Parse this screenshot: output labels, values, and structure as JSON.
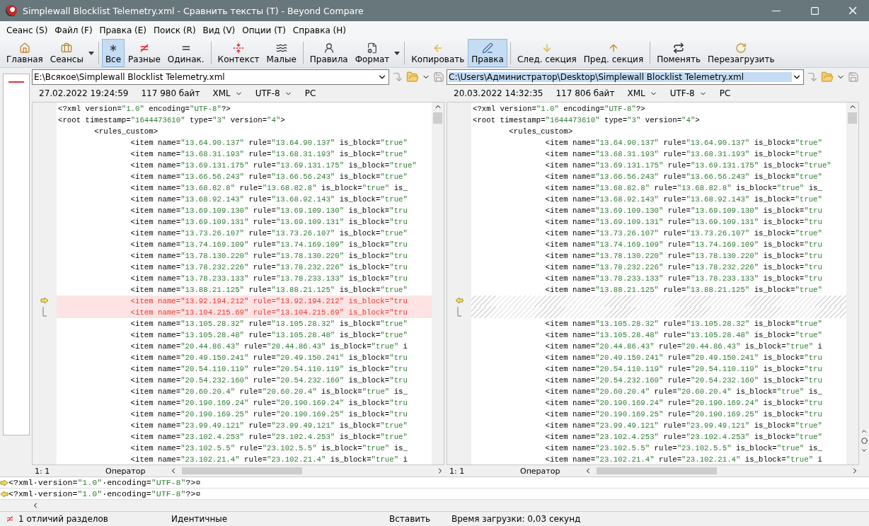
{
  "window": {
    "title": "Simplewall Blocklist Telemetry.xml - Сравнить тексты (T) - Beyond Compare"
  },
  "menu": [
    "Сеанс (S)",
    "Файл (F)",
    "Правка (E)",
    "Поиск (R)",
    "Вид (V)",
    "Опции (T)",
    "Справка (H)"
  ],
  "toolbar": [
    {
      "kind": "button",
      "label": "Главная",
      "selected": false,
      "dropdown": false
    },
    {
      "kind": "button",
      "label": "Сеансы",
      "selected": false,
      "dropdown": true
    },
    {
      "kind": "separator"
    },
    {
      "kind": "button",
      "label": "Все",
      "selected": true,
      "dropdown": false
    },
    {
      "kind": "button",
      "label": "Разные",
      "selected": false,
      "dropdown": false
    },
    {
      "kind": "button",
      "label": "Одинак.",
      "selected": false,
      "dropdown": false
    },
    {
      "kind": "separator"
    },
    {
      "kind": "button",
      "label": "Контекст",
      "selected": false,
      "dropdown": false
    },
    {
      "kind": "button",
      "label": "Малые",
      "selected": false,
      "dropdown": false
    },
    {
      "kind": "separator"
    },
    {
      "kind": "button",
      "label": "Правила",
      "selected": false,
      "dropdown": false
    },
    {
      "kind": "button",
      "label": "Формат",
      "selected": false,
      "dropdown": true
    },
    {
      "kind": "separator"
    },
    {
      "kind": "button",
      "label": "Копировать",
      "selected": false,
      "dropdown": false
    },
    {
      "kind": "button",
      "label": "Правка",
      "selected": true,
      "dropdown": false
    },
    {
      "kind": "separator"
    },
    {
      "kind": "button",
      "label": "След. секция",
      "selected": false,
      "dropdown": false
    },
    {
      "kind": "button",
      "label": "Пред. секция",
      "selected": false,
      "dropdown": false
    },
    {
      "kind": "separator"
    },
    {
      "kind": "button",
      "label": "Поменять",
      "selected": false,
      "dropdown": false
    },
    {
      "kind": "button",
      "label": "Перезагрузить",
      "selected": false,
      "dropdown": false
    }
  ],
  "panes": [
    {
      "path": "E:\\Всякое\\Simplewall Blocklist Telemetry.xml",
      "path_selected": false,
      "date": "27.02.2022 19:24:59",
      "size": "117 980 байт",
      "format": "XML",
      "encoding": "UTF-8",
      "line_endings": "PC",
      "position": "1: 1",
      "mode": "Оператор",
      "lines": [
        {
          "kind": "same",
          "text": "<?xml version=\"1.0\" encoding=\"UTF-8\"?>"
        },
        {
          "kind": "same",
          "text": "<root timestamp=\"1644473610\" type=\"3\" version=\"4\">"
        },
        {
          "kind": "same",
          "text": "        <rules_custom>"
        },
        {
          "kind": "same",
          "text": "                <item name=\"13.64.90.137\" rule=\"13.64.90.137\" is_block=\"true\""
        },
        {
          "kind": "same",
          "text": "                <item name=\"13.68.31.193\" rule=\"13.68.31.193\" is_block=\"true\""
        },
        {
          "kind": "same",
          "text": "                <item name=\"13.69.131.175\" rule=\"13.69.131.175\" is_block=\"true\""
        },
        {
          "kind": "same",
          "text": "                <item name=\"13.66.56.243\" rule=\"13.66.56.243\" is_block=\"true\""
        },
        {
          "kind": "same",
          "text": "                <item name=\"13.68.82.8\" rule=\"13.68.82.8\" is_block=\"true\" is_"
        },
        {
          "kind": "same",
          "text": "                <item name=\"13.68.92.143\" rule=\"13.68.92.143\" is_block=\"true\""
        },
        {
          "kind": "same",
          "text": "                <item name=\"13.69.109.130\" rule=\"13.69.109.130\" is_block=\"tru"
        },
        {
          "kind": "same",
          "text": "                <item name=\"13.69.109.131\" rule=\"13.69.109.131\" is_block=\"tru"
        },
        {
          "kind": "same",
          "text": "                <item name=\"13.73.26.107\" rule=\"13.73.26.107\" is_block=\"true\""
        },
        {
          "kind": "same",
          "text": "                <item name=\"13.74.169.109\" rule=\"13.74.169.109\" is_block=\"tru"
        },
        {
          "kind": "same",
          "text": "                <item name=\"13.78.130.220\" rule=\"13.78.130.220\" is_block=\"tru"
        },
        {
          "kind": "same",
          "text": "                <item name=\"13.78.232.226\" rule=\"13.78.232.226\" is_block=\"tru"
        },
        {
          "kind": "same",
          "text": "                <item name=\"13.78.233.133\" rule=\"13.78.233.133\" is_block=\"tru"
        },
        {
          "kind": "same",
          "text": "                <item name=\"13.88.21.125\" rule=\"13.88.21.125\" is_block=\"true\""
        },
        {
          "kind": "diff",
          "text": "                <item name=\"13.92.194.212\" rule=\"13.92.194.212\" is_block=\"tru"
        },
        {
          "kind": "diff",
          "text": "                <item name=\"13.104.215.69\" rule=\"13.104.215.69\" is_block=\"tru"
        },
        {
          "kind": "same",
          "text": "                <item name=\"13.105.28.32\" rule=\"13.105.28.32\" is_block=\"true\""
        },
        {
          "kind": "same",
          "text": "                <item name=\"13.105.28.48\" rule=\"13.105.28.48\" is_block=\"true\""
        },
        {
          "kind": "same",
          "text": "                <item name=\"20.44.86.43\" rule=\"20.44.86.43\" is_block=\"true\" i"
        },
        {
          "kind": "same",
          "text": "                <item name=\"20.49.150.241\" rule=\"20.49.150.241\" is_block=\"tru"
        },
        {
          "kind": "same",
          "text": "                <item name=\"20.54.110.119\" rule=\"20.54.110.119\" is_block=\"tru"
        },
        {
          "kind": "same",
          "text": "                <item name=\"20.54.232.160\" rule=\"20.54.232.160\" is_block=\"tru"
        },
        {
          "kind": "same",
          "text": "                <item name=\"20.60.20.4\" rule=\"20.60.20.4\" is_block=\"true\" is_"
        },
        {
          "kind": "same",
          "text": "                <item name=\"20.190.169.24\" rule=\"20.190.169.24\" is_block=\"tru"
        },
        {
          "kind": "same",
          "text": "                <item name=\"20.190.169.25\" rule=\"20.190.169.25\" is_block=\"tru"
        },
        {
          "kind": "same",
          "text": "                <item name=\"23.99.49.121\" rule=\"23.99.49.121\" is_block=\"true\""
        },
        {
          "kind": "same",
          "text": "                <item name=\"23.102.4.253\" rule=\"23.102.4.253\" is_block=\"true\""
        },
        {
          "kind": "same",
          "text": "                <item name=\"23.102.5.5\" rule=\"23.102.5.5\" is_block=\"true\" is_"
        },
        {
          "kind": "same",
          "text": "                <item name=\"23.102.21.4\" rule=\"23.102.21.4\" is_block=\"true\" i"
        }
      ]
    },
    {
      "path": "C:\\Users\\Администратор\\Desktop\\Simplewall Blocklist Telemetry.xml",
      "path_selected": true,
      "date": "20.03.2022 14:32:35",
      "size": "117 806 байт",
      "format": "XML",
      "encoding": "UTF-8",
      "line_endings": "PC",
      "position": "1: 1",
      "mode": "Оператор",
      "lines": [
        {
          "kind": "same",
          "text": "<?xml version=\"1.0\" encoding=\"UTF-8\"?>"
        },
        {
          "kind": "same",
          "text": "<root timestamp=\"1644473610\" type=\"3\" version=\"4\">"
        },
        {
          "kind": "same",
          "text": "        <rules_custom>"
        },
        {
          "kind": "same",
          "text": "                <item name=\"13.64.90.137\" rule=\"13.64.90.137\" is_block=\"true\""
        },
        {
          "kind": "same",
          "text": "                <item name=\"13.68.31.193\" rule=\"13.68.31.193\" is_block=\"true\""
        },
        {
          "kind": "same",
          "text": "                <item name=\"13.69.131.175\" rule=\"13.69.131.175\" is_block=\"true\""
        },
        {
          "kind": "same",
          "text": "                <item name=\"13.66.56.243\" rule=\"13.66.56.243\" is_block=\"true\""
        },
        {
          "kind": "same",
          "text": "                <item name=\"13.68.82.8\" rule=\"13.68.82.8\" is_block=\"true\" is_"
        },
        {
          "kind": "same",
          "text": "                <item name=\"13.68.92.143\" rule=\"13.68.92.143\" is_block=\"true\""
        },
        {
          "kind": "same",
          "text": "                <item name=\"13.69.109.130\" rule=\"13.69.109.130\" is_block=\"tru"
        },
        {
          "kind": "same",
          "text": "                <item name=\"13.69.109.131\" rule=\"13.69.109.131\" is_block=\"tru"
        },
        {
          "kind": "same",
          "text": "                <item name=\"13.73.26.107\" rule=\"13.73.26.107\" is_block=\"true\""
        },
        {
          "kind": "same",
          "text": "                <item name=\"13.74.169.109\" rule=\"13.74.169.109\" is_block=\"tru"
        },
        {
          "kind": "same",
          "text": "                <item name=\"13.78.130.220\" rule=\"13.78.130.220\" is_block=\"tru"
        },
        {
          "kind": "same",
          "text": "                <item name=\"13.78.232.226\" rule=\"13.78.232.226\" is_block=\"tru"
        },
        {
          "kind": "same",
          "text": "                <item name=\"13.78.233.133\" rule=\"13.78.233.133\" is_block=\"tru"
        },
        {
          "kind": "same",
          "text": "                <item name=\"13.88.21.125\" rule=\"13.88.21.125\" is_block=\"true\""
        },
        {
          "kind": "gap"
        },
        {
          "kind": "gap"
        },
        {
          "kind": "same",
          "text": "                <item name=\"13.105.28.32\" rule=\"13.105.28.32\" is_block=\"true\""
        },
        {
          "kind": "same",
          "text": "                <item name=\"13.105.28.48\" rule=\"13.105.28.48\" is_block=\"true\""
        },
        {
          "kind": "same",
          "text": "                <item name=\"20.44.86.43\" rule=\"20.44.86.43\" is_block=\"true\" i"
        },
        {
          "kind": "same",
          "text": "                <item name=\"20.49.150.241\" rule=\"20.49.150.241\" is_block=\"tru"
        },
        {
          "kind": "same",
          "text": "                <item name=\"20.54.110.119\" rule=\"20.54.110.119\" is_block=\"tru"
        },
        {
          "kind": "same",
          "text": "                <item name=\"20.54.232.160\" rule=\"20.54.232.160\" is_block=\"tru"
        },
        {
          "kind": "same",
          "text": "                <item name=\"20.60.20.4\" rule=\"20.60.20.4\" is_block=\"true\" is_"
        },
        {
          "kind": "same",
          "text": "                <item name=\"20.190.169.24\" rule=\"20.190.169.24\" is_block=\"tru"
        },
        {
          "kind": "same",
          "text": "                <item name=\"20.190.169.25\" rule=\"20.190.169.25\" is_block=\"tru"
        },
        {
          "kind": "same",
          "text": "                <item name=\"23.99.49.121\" rule=\"23.99.49.121\" is_block=\"true\""
        },
        {
          "kind": "same",
          "text": "                <item name=\"23.102.4.253\" rule=\"23.102.4.253\" is_block=\"true\""
        },
        {
          "kind": "same",
          "text": "                <item name=\"23.102.5.5\" rule=\"23.102.5.5\" is_block=\"true\" is_"
        },
        {
          "kind": "same",
          "text": "                <item name=\"23.102.21.4\" rule=\"23.102.21.4\" is_block=\"true\" i"
        }
      ]
    }
  ],
  "merge_lines": [
    {
      "kind": "from_left",
      "text": "<?xml·version=\"1.0\"·encoding=\"UTF-8\"?>¤"
    },
    {
      "kind": "from_right",
      "text": "<?xml·version=\"1.0\"·encoding=\"UTF-8\"?>¤"
    }
  ],
  "status_bar": {
    "differences": "1 отличий разделов",
    "comparison": "Идентичные",
    "insert_mode": "Вставить",
    "load_time": "Время загрузки: 0,03 секунд"
  }
}
